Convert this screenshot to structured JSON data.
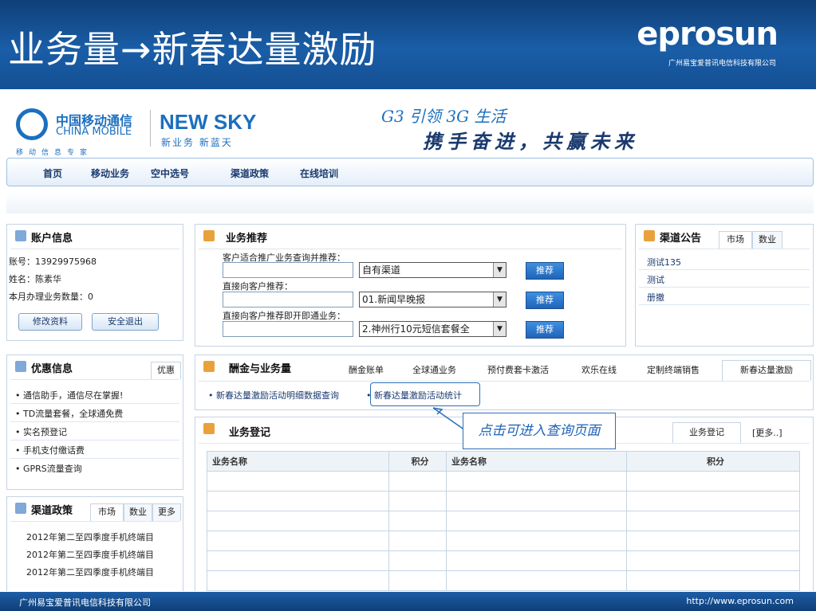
{
  "slide": {
    "title": "业务量→新春达量激励",
    "brand": "eprosun",
    "brand_sub": "广州易宝爱普讯电信科技有限公司",
    "footer_left": "广州易宝爱普讯电信科技有限公司",
    "footer_right": "http://www.eprosun.com"
  },
  "header": {
    "cm_cn": "中国移动通信",
    "cm_en": "CHINA MOBILE",
    "cm_tag": "移动信息专家",
    "newsky": "NEW SKY",
    "newsky_sub": "新业务  新蓝天",
    "slogan1": "G3 引领 3G 生活",
    "slogan2": "携手奋进，共赢未来"
  },
  "nav": {
    "items": [
      "首页",
      "移动业务",
      "空中选号",
      "渠道政策",
      "在线培训"
    ]
  },
  "account": {
    "title": "账户信息",
    "account_no": "账号：13929975968",
    "name": "姓名：陈素华",
    "month_count": "本月办理业务数量：0",
    "edit_button": "修改资料",
    "logout_button": "安全退出"
  },
  "recommend": {
    "title": "业务推荐",
    "label1": "客户适合推广业务查询并推荐：",
    "label2": "直接向客户推荐：",
    "label3": "直接向客户推荐即开即通业务：",
    "select1": "自有渠道",
    "select2": "01.新闻早晚报",
    "select3": "2.神州行10元短信套餐全",
    "button": "推荐"
  },
  "notice": {
    "title": "渠道公告",
    "tabs": [
      "市场",
      "数业"
    ],
    "items": [
      "测试135",
      "测试",
      "册撤"
    ]
  },
  "promo": {
    "title": "优惠信息",
    "tab": "优惠",
    "items": [
      "通信助手，通信尽在掌握!",
      "TD流量套餐，全球通免费",
      "实名预登记",
      "手机支付缴话费",
      "GPRS流量查询"
    ]
  },
  "policy": {
    "title": "渠道政策",
    "tabs": [
      "市场",
      "数业",
      "更多"
    ],
    "items": [
      "2012年第二至四季度手机终端目",
      "2012年第二至四季度手机终端目",
      "2012年第二至四季度手机终端目"
    ]
  },
  "commission": {
    "title": "酬金与业务量",
    "tabs": [
      "酬金账单",
      "全球通业务",
      "预付费套卡激活",
      "欢乐在线",
      "定制终端销售",
      "新春达量激励"
    ],
    "link1": "新春达量激励活动明细数据查询",
    "link2": "新春达量激励活动统计"
  },
  "register": {
    "title": "业务登记",
    "tab1": "业务登记",
    "more": "[更多..]",
    "headers": [
      "业务名称",
      "积分",
      "业务名称",
      "积分"
    ]
  },
  "callout": "点击可进入查询页面",
  "colors": {
    "brand_blue": "#1b6fbf",
    "banner": "#1a5ea8",
    "button_blue": "#1f64b8"
  }
}
